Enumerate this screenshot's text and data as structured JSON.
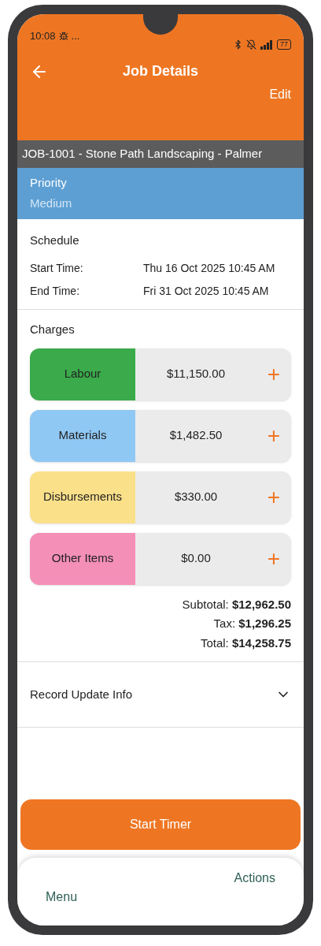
{
  "status_bar": {
    "time": "10:08",
    "more": "...",
    "battery": "77"
  },
  "header": {
    "title": "Job Details",
    "action": "Edit"
  },
  "job_bar": {
    "text": "JOB-1001 - Stone Path Landscaping - Palmer"
  },
  "priority": {
    "label": "Priority",
    "value": "Medium"
  },
  "schedule": {
    "title": "Schedule",
    "rows": [
      {
        "label": "Start Time:",
        "value": "Thu 16 Oct 2025 10:45 AM"
      },
      {
        "label": "End Time:",
        "value": "Fri 31 Oct 2025 10:45 AM"
      }
    ]
  },
  "charges": {
    "title": "Charges",
    "items": [
      {
        "label": "Labour",
        "amount": "$11,150.00",
        "color": "#3aaa4a",
        "add": "+"
      },
      {
        "label": "Materials",
        "amount": "$1,482.50",
        "color": "#90c8f4",
        "add": "+"
      },
      {
        "label": "Disbursements",
        "amount": "$330.00",
        "color": "#fbe08a",
        "add": "+"
      },
      {
        "label": "Other Items",
        "amount": "$0.00",
        "color": "#f48fb8",
        "add": "+"
      }
    ],
    "totals": [
      "Subtotal: **$12,962.50**",
      "Tax: **$1,296.25**",
      "Total: **$14,258.75**"
    ]
  },
  "record_update": {
    "label": "Record Update Info",
    "expanded": false
  },
  "primary_button": "Start Timer",
  "bottom_bar": {
    "left": "Menu",
    "right": "Actions"
  }
}
